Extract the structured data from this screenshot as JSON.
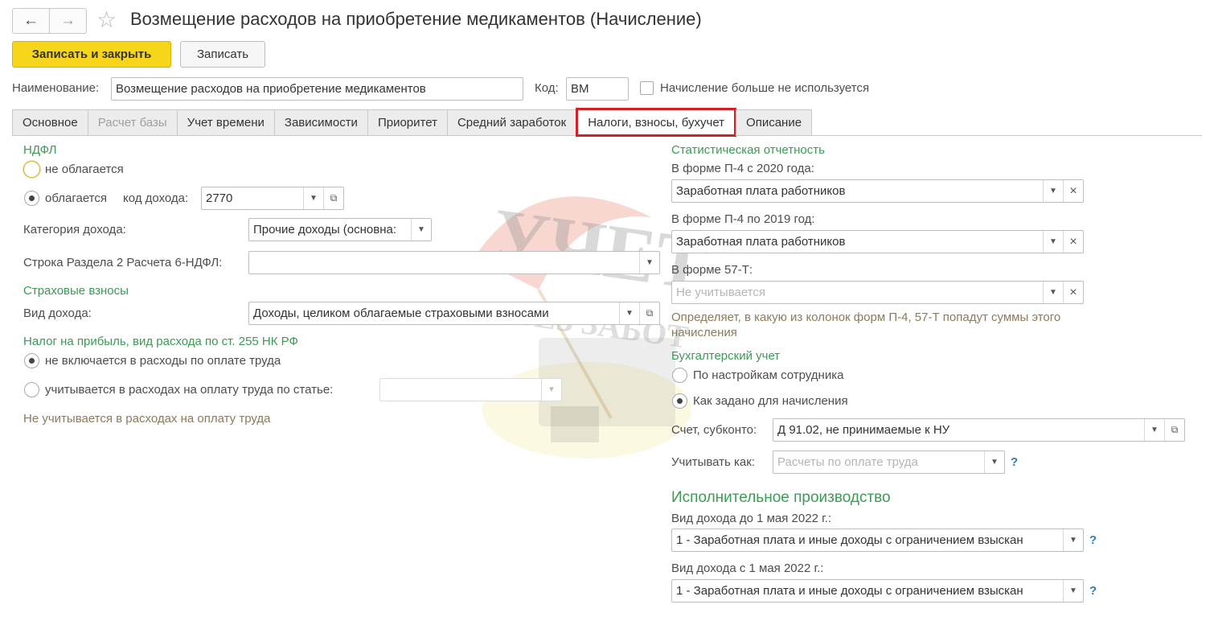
{
  "window": {
    "title": "Возмещение расходов на приобретение медикаментов (Начисление)",
    "nav_back": "←",
    "nav_forward": "→",
    "favorite_icon": "☆"
  },
  "toolbar": {
    "save_close_label": "Записать и закрыть",
    "save_label": "Записать"
  },
  "header": {
    "name_label": "Наименование:",
    "name_value": "Возмещение расходов на приобретение медикаментов",
    "code_label": "Код:",
    "code_value": "ВМ",
    "unused_label": "Начисление больше не используется"
  },
  "tabs": [
    {
      "label": "Основное"
    },
    {
      "label": "Расчет базы"
    },
    {
      "label": "Учет времени"
    },
    {
      "label": "Зависимости"
    },
    {
      "label": "Приоритет"
    },
    {
      "label": "Средний заработок"
    },
    {
      "label": "Налоги, взносы, бухучет"
    },
    {
      "label": "Описание"
    }
  ],
  "ndfl": {
    "section_title": "НДФЛ",
    "not_taxed_label": "не облагается",
    "taxed_label": "облагается",
    "income_code_label": "код дохода:",
    "income_code_value": "2770",
    "income_category_label": "Категория дохода:",
    "income_category_value": "Прочие доходы (основна:",
    "row_6ndfl_label": "Строка Раздела 2 Расчета 6-НДФЛ:",
    "row_6ndfl_value": ""
  },
  "insurance": {
    "section_title": "Страховые взносы",
    "income_type_label": "Вид дохода:",
    "income_type_value": "Доходы, целиком облагаемые страховыми взносами"
  },
  "profit_tax": {
    "section_title": "Налог на прибыль, вид расхода по ст. 255 НК РФ",
    "not_included_label": "не включается в расходы по оплате труда",
    "included_label": "учитывается в расходах на оплату труда по статье:",
    "included_value": "",
    "note": "Не учитывается в расходах на оплату труда"
  },
  "statistics": {
    "section_title": "Статистическая отчетность",
    "p4_2020_label": "В форме П-4 с 2020 года:",
    "p4_2020_value": "Заработная плата работников",
    "p4_2019_label": "В форме П-4 по 2019 год:",
    "p4_2019_value": "Заработная плата работников",
    "f57t_label": "В форме 57-Т:",
    "f57t_placeholder": "Не учитывается",
    "note": "Определяет, в какую из колонок форм П-4, 57-Т попадут суммы этого начисления"
  },
  "accounting": {
    "section_title": "Бухгалтерский учет",
    "by_employee_label": "По настройкам сотрудника",
    "as_set_label": "Как задано для начисления",
    "account_label": "Счет, субконто:",
    "account_value": "Д 91.02, не принимаемые к НУ",
    "treat_as_label": "Учитывать как:",
    "treat_as_placeholder": "Расчеты по оплате труда",
    "help": "?"
  },
  "enforcement": {
    "section_title": "Исполнительное производство",
    "before_label": "Вид дохода до 1 мая 2022 г.:",
    "before_value": "1 - Заработная плата и иные доходы с ограничением взыскан",
    "after_label": "Вид дохода с 1 мая 2022 г.:",
    "after_value": "1 - Заработная плата и иные доходы с ограничением взыскан",
    "help": "?"
  },
  "watermark": {
    "line1": "УЧЕТ",
    "line2": "БЕЗ ЗАБОТ"
  },
  "colors": {
    "section_green": "#3d9a55",
    "active_tab_border": "#d41f26",
    "primary_button": "#f7d51b",
    "help_blue": "#2f7bbf"
  }
}
